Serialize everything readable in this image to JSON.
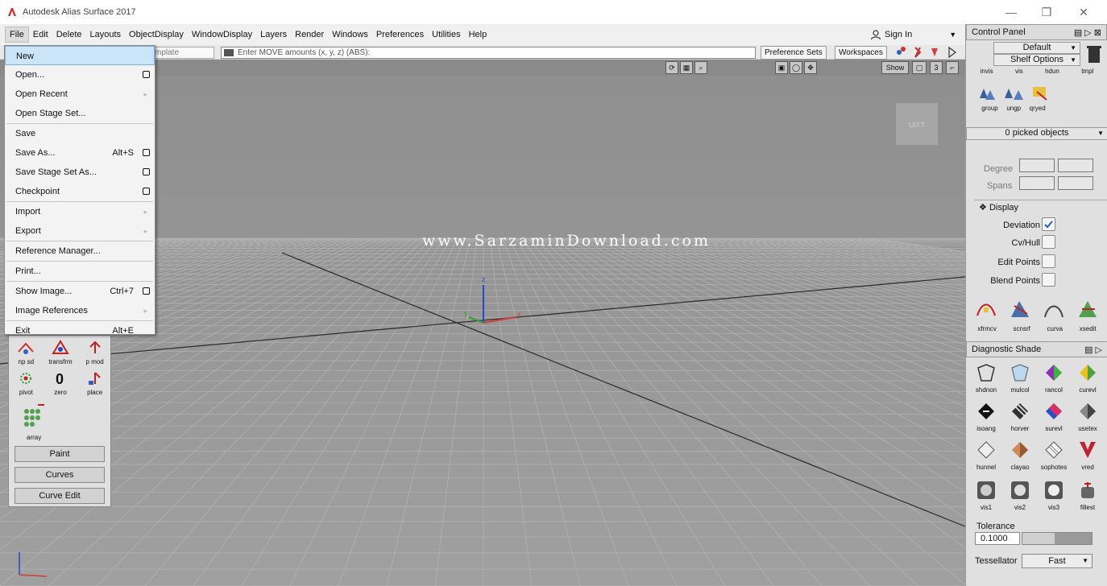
{
  "window": {
    "title": "Autodesk Alias Surface 2017",
    "min": "—",
    "max": "❐",
    "close": "✕"
  },
  "menubar": [
    "File",
    "Edit",
    "Delete",
    "Layouts",
    "ObjectDisplay",
    "WindowDisplay",
    "Layers",
    "Render",
    "Windows",
    "Preferences",
    "Utilities",
    "Help"
  ],
  "signin": {
    "label": "Sign In"
  },
  "toolbar": {
    "template_field": "mplate",
    "move_placeholder": "Enter MOVE amounts (x, y, z) (ABS):",
    "preference_sets": "Preference Sets",
    "workspaces": "Workspaces",
    "show": "Show",
    "three": "3"
  },
  "file_menu": [
    {
      "label": "New",
      "highlight": true
    },
    {
      "label": "Open...",
      "option": true
    },
    {
      "label": "Open Recent",
      "submenu": true
    },
    {
      "label": "Open Stage Set...",
      "sep_after": true
    },
    {
      "label": "Save"
    },
    {
      "label": "Save As...",
      "shortcut": "Alt+S",
      "option": true
    },
    {
      "label": "Save Stage Set As...",
      "option": true
    },
    {
      "label": "Checkpoint",
      "option": true,
      "sep_after": true
    },
    {
      "label": "Import",
      "submenu": true
    },
    {
      "label": "Export",
      "submenu": true,
      "sep_after": true
    },
    {
      "label": "Reference Manager...",
      "sep_after": true
    },
    {
      "label": "Print...",
      "sep_after": true
    },
    {
      "label": "Show Image...",
      "shortcut": "Ctrl+7",
      "option": true
    },
    {
      "label": "Image References",
      "submenu": true,
      "sep_after": true
    },
    {
      "label": "Exit",
      "shortcut": "Alt+E"
    }
  ],
  "viewport": {
    "watermark": "www.SarzaminDownload.com",
    "viewcube_label": "LEFT",
    "axis_x": "x",
    "axis_y": "y",
    "axis_z": "z"
  },
  "palette": {
    "row1": [
      "np sd",
      "transfrm",
      "p mod"
    ],
    "row2": [
      "pivot",
      "zero",
      "place"
    ],
    "row3": [
      "array"
    ],
    "buttons": [
      "Paint",
      "Curves",
      "Curve Edit"
    ]
  },
  "control_panel": {
    "title": "Control Panel",
    "default": "Default",
    "shelf_options": "Shelf Options",
    "shelf_top": [
      "invis",
      "vis",
      "hdun",
      "tmpl"
    ],
    "shelf_mid": [
      "group",
      "ungp",
      "qryed"
    ],
    "picked": "0 picked objects",
    "degree": "Degree",
    "spans": "Spans",
    "display_header": "Display",
    "display_items": [
      "Deviation",
      "Cv/Hull",
      "Edit Points",
      "Blend Points"
    ],
    "shelf_bottom": [
      "xfrmcv",
      "scnsrf",
      "curva",
      "xsedit"
    ]
  },
  "diagnostic": {
    "title": "Diagnostic Shade",
    "row1": [
      "shdnon",
      "mulcol",
      "rancol",
      "curevl"
    ],
    "row2": [
      "isoang",
      "horver",
      "surevl",
      "usetex"
    ],
    "row3": [
      "hunnel",
      "clayao",
      "sophotes",
      "vred"
    ],
    "row4": [
      "vis1",
      "vis2",
      "vis3",
      "fillest"
    ],
    "tolerance_label": "Tolerance",
    "tolerance_value": "0.1000",
    "tessellator_label": "Tessellator",
    "tessellator_value": "Fast"
  },
  "colors": {
    "viewport": "#929292",
    "grid": "#a6a6a6",
    "menu_highlight": "#cce4f7",
    "axis_x": "#d23c3c",
    "axis_y": "#2da02d",
    "axis_z": "#2846c8"
  }
}
